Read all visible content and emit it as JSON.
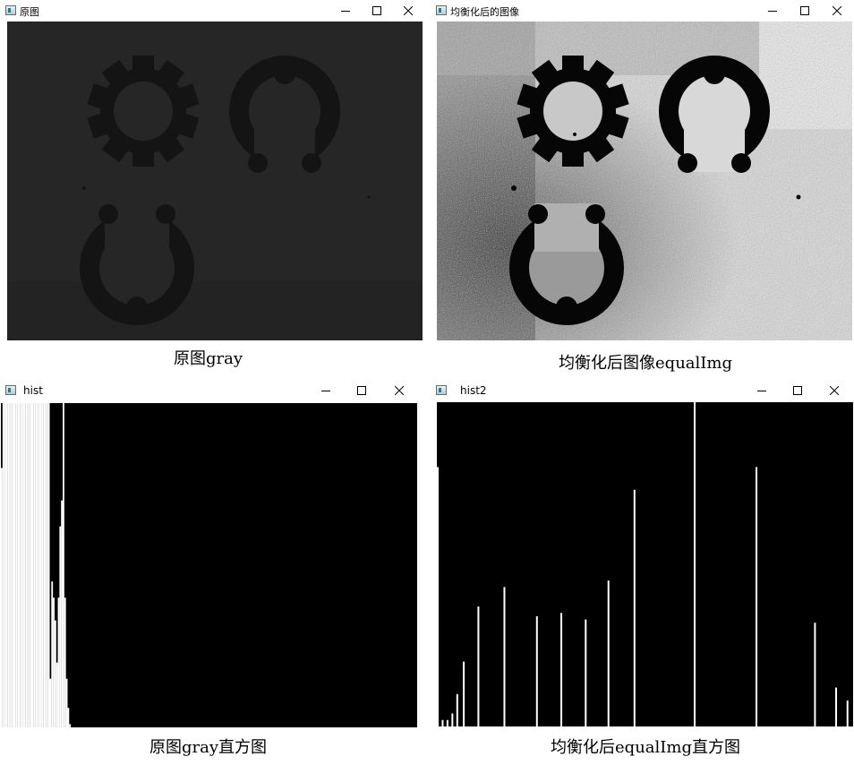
{
  "windows": {
    "original": {
      "title": "原图"
    },
    "equalized": {
      "title": "均衡化后的图像"
    },
    "hist": {
      "title": "hist"
    },
    "hist2": {
      "title": "hist2"
    }
  },
  "window_controls": {
    "minimize_icon": "minimize-icon",
    "maximize_icon": "maximize-icon",
    "close_icon": "close-icon"
  },
  "captions": {
    "original": "原图gray",
    "equalized": "均衡化后图像equalImg",
    "hist": "原图gray直方图",
    "hist2": "均衡化后equalImg直方图"
  },
  "colors": {
    "original_background": "#262626",
    "original_objects": "#141414",
    "equalized_light": "#e6e6e6",
    "equalized_dark": "#060606",
    "histogram_background": "#000000",
    "histogram_bars": "#ffffff"
  },
  "chart_data": [
    {
      "type": "bar",
      "title": "",
      "description": "gray-level histogram of the original image; all pixels concentrated in the lowest intensities",
      "bins": 256,
      "x": [
        0,
        1,
        2,
        3,
        4,
        5,
        6,
        7,
        8,
        9,
        10,
        11,
        12,
        13,
        14,
        15,
        16,
        17,
        18,
        19,
        20,
        21,
        22,
        23,
        24,
        25,
        26,
        27,
        28,
        29,
        30,
        31,
        32,
        33,
        34,
        35,
        36,
        37,
        38,
        39,
        40,
        41,
        42
      ],
      "values": [
        0.8,
        1.0,
        1.0,
        1.0,
        1.0,
        1.0,
        1.0,
        1.0,
        1.0,
        1.0,
        1.0,
        1.0,
        1.0,
        1.0,
        1.0,
        1.0,
        1.0,
        1.0,
        1.0,
        1.0,
        1.0,
        1.0,
        1.0,
        1.0,
        1.0,
        1.0,
        1.0,
        1.0,
        1.0,
        1.0,
        0.15,
        0.45,
        0.4,
        0.33,
        0.2,
        0.4,
        0.62,
        0.7,
        1.0,
        0.4,
        0.15,
        0.06,
        0.01
      ],
      "ylim": [
        0,
        1
      ]
    },
    {
      "type": "bar",
      "title": "",
      "description": "gray-level histogram after equalization; sparse spikes spread across the full range",
      "bins": 256,
      "x": [
        0,
        3,
        6,
        9,
        12,
        16,
        25,
        41,
        61,
        76,
        91,
        105,
        121,
        158,
        196,
        232,
        245,
        252
      ],
      "values": [
        0.8,
        0.02,
        0.02,
        0.04,
        0.1,
        0.2,
        0.37,
        0.43,
        0.34,
        0.35,
        0.33,
        0.45,
        0.73,
        1.0,
        0.8,
        0.32,
        0.12,
        0.08
      ],
      "ylim": [
        0,
        1
      ]
    }
  ]
}
